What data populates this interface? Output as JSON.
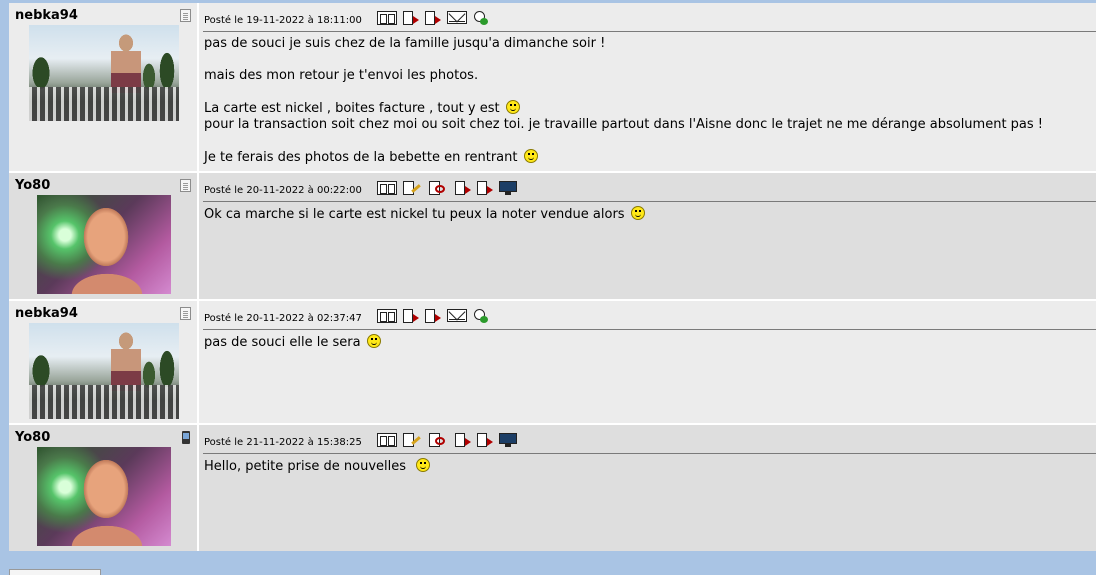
{
  "posts": [
    {
      "username": "nebka94",
      "user_status_icon": "profile-icon",
      "avatar": "avatar-nebka94",
      "date": "Posté le 19-11-2022 à 18:11:00",
      "actions": [
        "quote-icon",
        "answer-icon",
        "add-multiquote-icon",
        "mail-icon",
        "private-message-icon"
      ],
      "lines": [
        "pas de souci je suis chez de la famille jusqu'a dimanche soir !",
        "",
        "mais des mon retour je t'envoi les photos.",
        "",
        "La carte est nickel , boites facture , tout y est",
        "pour la transaction soit chez moi ou soit chez toi. je travaille partout dans l'Aisne donc le trajet ne me dérange absolument pas !",
        "",
        "Je te ferais des photos de la bebette en rentrant"
      ]
    },
    {
      "username": "Yo80",
      "user_status_icon": "profile-icon",
      "avatar": "avatar-yo80",
      "date": "Posté le 20-11-2022 à 00:22:00",
      "actions": [
        "quote-icon",
        "edit-icon",
        "delete-icon",
        "answer-icon",
        "add-multiquote-icon",
        "desktop-icon"
      ],
      "lines": [
        "Ok ca marche si le carte est nickel tu peux la noter vendue alors"
      ]
    },
    {
      "username": "nebka94",
      "user_status_icon": "profile-icon",
      "avatar": "avatar-nebka94",
      "date": "Posté le 20-11-2022 à 02:37:47",
      "actions": [
        "quote-icon",
        "answer-icon",
        "add-multiquote-icon",
        "mail-icon",
        "private-message-icon"
      ],
      "lines": [
        "pas de souci elle le sera"
      ]
    },
    {
      "username": "Yo80",
      "user_status_icon": "mobile-icon",
      "avatar": "avatar-yo80",
      "date": "Posté le 21-11-2022 à 15:38:25",
      "actions": [
        "quote-icon",
        "edit-icon",
        "delete-icon",
        "answer-icon",
        "add-multiquote-icon",
        "desktop-icon"
      ],
      "lines": [
        "Hello, petite prise de nouvelles"
      ]
    }
  ]
}
